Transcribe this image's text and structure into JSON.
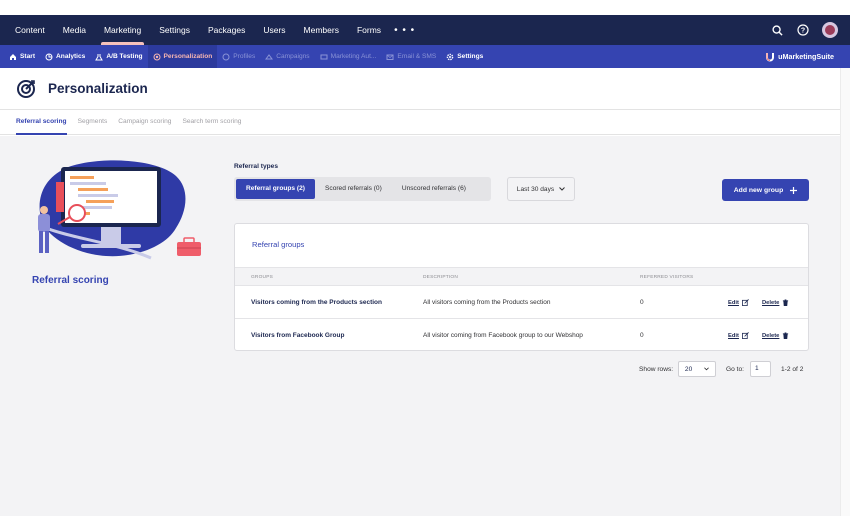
{
  "topnav": {
    "items": [
      {
        "label": "Content",
        "active": false
      },
      {
        "label": "Media",
        "active": false
      },
      {
        "label": "Marketing",
        "active": true
      },
      {
        "label": "Settings",
        "active": false
      },
      {
        "label": "Packages",
        "active": false
      },
      {
        "label": "Users",
        "active": false
      },
      {
        "label": "Members",
        "active": false
      },
      {
        "label": "Forms",
        "active": false
      }
    ],
    "more": "• • •",
    "icons": [
      "search-icon",
      "help-icon",
      "user-avatar"
    ]
  },
  "subnav": {
    "items": [
      {
        "label": "Start",
        "icon": "home-icon",
        "state": "normal"
      },
      {
        "label": "Analytics",
        "icon": "analytics-icon",
        "state": "normal"
      },
      {
        "label": "A/B Testing",
        "icon": "flask-icon",
        "state": "normal"
      },
      {
        "label": "Personalization",
        "icon": "target-icon",
        "state": "active"
      },
      {
        "label": "Profiles",
        "icon": "profiles-icon",
        "state": "disabled"
      },
      {
        "label": "Campaigns",
        "icon": "campaigns-icon",
        "state": "disabled"
      },
      {
        "label": "Marketing Aut...",
        "icon": "automation-icon",
        "state": "disabled"
      },
      {
        "label": "Email & SMS",
        "icon": "email-icon",
        "state": "disabled"
      },
      {
        "label": "Settings",
        "icon": "gear-icon",
        "state": "normal"
      }
    ],
    "brand": "uMarketingSuite"
  },
  "page": {
    "title": "Personalization",
    "tabs": [
      "Referral scoring",
      "Segments",
      "Campaign scoring",
      "Search term scoring"
    ],
    "active_tab": "Referral scoring"
  },
  "left_panel": {
    "title": "Referral scoring"
  },
  "referral_types": {
    "label": "Referral types",
    "options": [
      "Referral groups (2)",
      "Scored referrals (0)",
      "Unscored referrals (6)"
    ],
    "selected": "Referral groups (2)"
  },
  "date_range": {
    "value": "Last 30 days"
  },
  "add_button": {
    "label": "Add new group"
  },
  "table": {
    "title": "Referral groups",
    "columns": [
      "GROUPS",
      "DESCRIPTION",
      "REFERRED VISITORS"
    ],
    "rows": [
      {
        "name": "Visitors coming from the Products section",
        "description": "All visitors coming from the Products section",
        "visitors": "0"
      },
      {
        "name": "Visitors from Facebook Group",
        "description": "All visitor coming from Facebook group to our Webshop",
        "visitors": "0"
      }
    ],
    "edit_label": "Edit",
    "delete_label": "Delete"
  },
  "pagination": {
    "show_rows_label": "Show rows:",
    "rows_value": "20",
    "goto_label": "Go to:",
    "goto_value": "1",
    "range": "1-2 of 2"
  },
  "colors": {
    "topbar": "#1b264f",
    "subbar": "#3544b1",
    "accent": "#3544b1",
    "active_pink": "#f7b6b1"
  }
}
